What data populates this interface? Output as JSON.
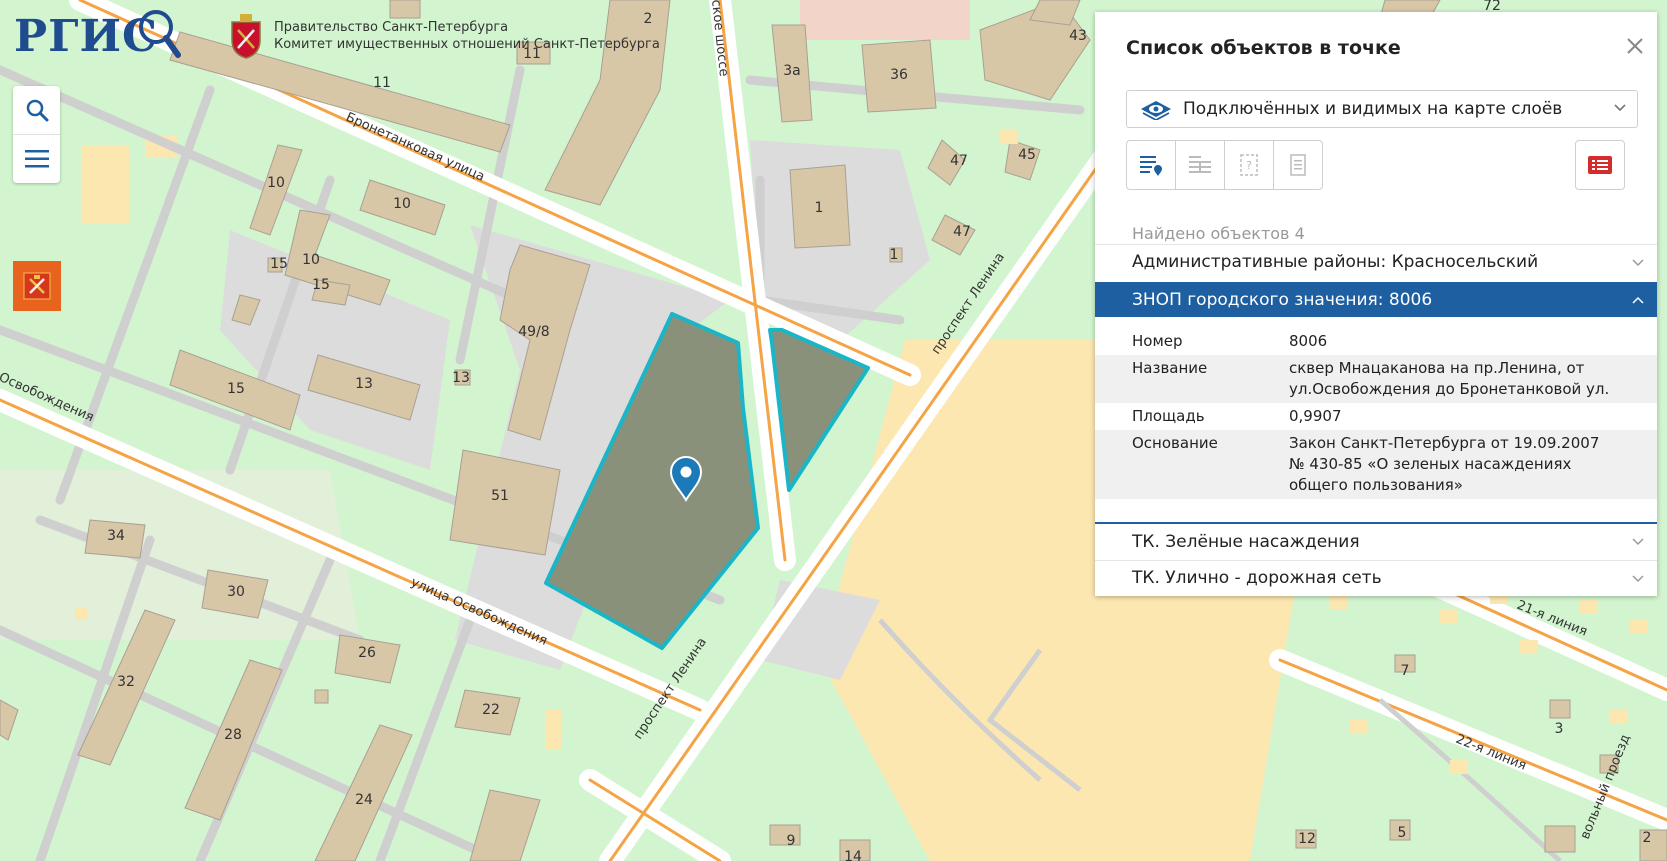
{
  "header": {
    "logo_text": "РГИС",
    "gov_line1": "Правительство Санкт-Петербурга",
    "gov_line2": "Комитет имущественных отношений Санкт-Петербурга"
  },
  "tools": {
    "search_icon": "search-icon",
    "menu_icon": "menu-icon",
    "flag_icon": "spb-flag-icon"
  },
  "colors": {
    "accent": "#1d5fa0",
    "map_green": "#d2f5cf",
    "road_orange": "#f4a444",
    "building": "#d8c7a6",
    "selection": "#1bb5c8",
    "selection_fill": "#8a917b"
  },
  "map": {
    "streets": [
      {
        "text": "Бронетанковая улица"
      },
      {
        "text": "улица Освобождения"
      },
      {
        "text": "Освобождения"
      },
      {
        "text": "проспект Ленина"
      },
      {
        "text": "проспект Ленина"
      },
      {
        "text": "ское шоссе"
      },
      {
        "text": "21-я линия"
      },
      {
        "text": "22-я линия"
      },
      {
        "text": "вольный проезд"
      }
    ],
    "numbers": [
      {
        "text": "11"
      },
      {
        "text": "2"
      },
      {
        "text": "3а"
      },
      {
        "text": "36"
      },
      {
        "text": "43"
      },
      {
        "text": "72"
      },
      {
        "text": "10"
      },
      {
        "text": "10"
      },
      {
        "text": "10"
      },
      {
        "text": "15"
      },
      {
        "text": "15"
      },
      {
        "text": "15"
      },
      {
        "text": "13"
      },
      {
        "text": "13"
      },
      {
        "text": "49/8"
      },
      {
        "text": "51"
      },
      {
        "text": "1"
      },
      {
        "text": "1"
      },
      {
        "text": "47"
      },
      {
        "text": "47"
      },
      {
        "text": "45"
      },
      {
        "text": "34"
      },
      {
        "text": "30"
      },
      {
        "text": "26"
      },
      {
        "text": "22"
      },
      {
        "text": "32"
      },
      {
        "text": "28"
      },
      {
        "text": "24"
      },
      {
        "text": "9"
      },
      {
        "text": "14"
      },
      {
        "text": "7"
      },
      {
        "text": "3"
      },
      {
        "text": "12"
      },
      {
        "text": "5"
      },
      {
        "text": "2"
      },
      {
        "text": "11"
      }
    ]
  },
  "panel": {
    "title": "Список объектов в точке",
    "select_value": "Подключённых и видимых на карте слоёв",
    "found_text": "Найдено объектов 4",
    "sections": [
      {
        "label": "Административные районы: Красносельский"
      },
      {
        "label": "ЗНОП городского значения: 8006"
      },
      {
        "label": "ТК. Зелёные насаждения"
      },
      {
        "label": "ТК. Улично - дорожная сеть"
      }
    ],
    "attributes": [
      {
        "key": "Номер",
        "value": "8006"
      },
      {
        "key": "Название",
        "value": "сквер Мнацаканова на пр.Ленина, от ул.Освобождения до Бронетанковой ул."
      },
      {
        "key": "Площадь",
        "value": "0,9907"
      },
      {
        "key": "Основание",
        "value": "Закон Санкт-Петербурга от 19.09.2007 № 430-85 «О зеленых насаждениях общего пользования»"
      }
    ]
  }
}
